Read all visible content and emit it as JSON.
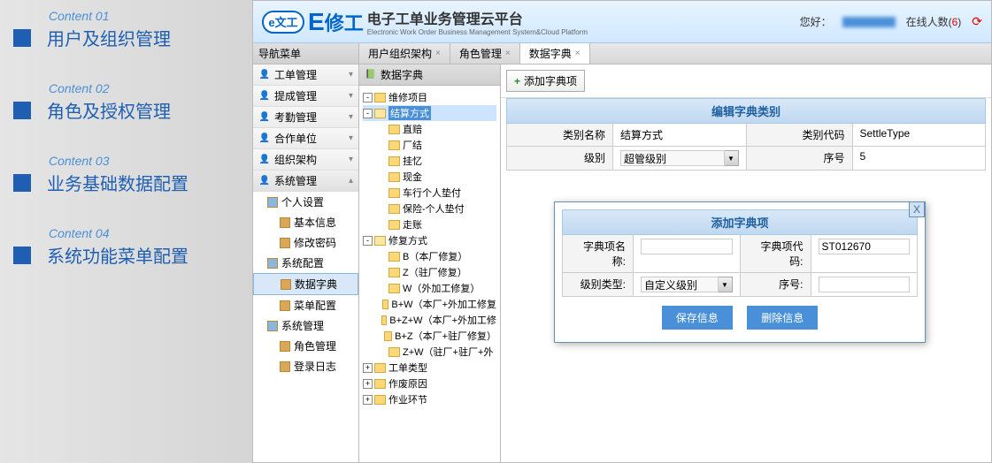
{
  "left_panel": {
    "items": [
      {
        "label": "Content 01",
        "title": "用户及组织管理"
      },
      {
        "label": "Content 02",
        "title": "角色及授权管理"
      },
      {
        "label": "Content 03",
        "title": "业务基础数据配置"
      },
      {
        "label": "Content 04",
        "title": "系统功能菜单配置"
      }
    ]
  },
  "header": {
    "logo_small": "e文工",
    "logo_e": "E",
    "logo_text": "修工",
    "title_cn": "电子工单业务管理云平台",
    "title_en": "Electronic Work Order Business Management System&Cloud Platform",
    "greeting": "您好：",
    "online_label": "在线人数(",
    "online_count": "6",
    "online_close": ")"
  },
  "nav": {
    "header": "导航菜单",
    "items": [
      {
        "label": "工单管理"
      },
      {
        "label": "提成管理"
      },
      {
        "label": "考勤管理"
      },
      {
        "label": "合作单位"
      },
      {
        "label": "组织架构"
      },
      {
        "label": "系统管理",
        "active": true
      }
    ],
    "sub_groups": [
      {
        "label": "个人设置",
        "children": [
          {
            "label": "基本信息"
          },
          {
            "label": "修改密码"
          }
        ]
      },
      {
        "label": "系统配置",
        "children": [
          {
            "label": "数据字典",
            "selected": true
          },
          {
            "label": "菜单配置"
          }
        ]
      },
      {
        "label": "系统管理",
        "children": [
          {
            "label": "角色管理"
          },
          {
            "label": "登录日志"
          }
        ]
      }
    ]
  },
  "tabs": [
    {
      "label": "用户组织架构"
    },
    {
      "label": "角色管理"
    },
    {
      "label": "数据字典",
      "active": true
    }
  ],
  "tree": {
    "header": "数据字典",
    "nodes": [
      {
        "level": 0,
        "toggle": "-",
        "label": "维修项目"
      },
      {
        "level": 0,
        "toggle": "-",
        "label": "结算方式",
        "selected": true,
        "open": true
      },
      {
        "level": 1,
        "label": "直赔"
      },
      {
        "level": 1,
        "label": "厂结"
      },
      {
        "level": 1,
        "label": "挂忆"
      },
      {
        "level": 1,
        "label": "现金"
      },
      {
        "level": 1,
        "label": "车行个人垫付"
      },
      {
        "level": 1,
        "label": "保险-个人垫付"
      },
      {
        "level": 1,
        "label": "走账"
      },
      {
        "level": 0,
        "toggle": "-",
        "label": "修复方式",
        "open": true
      },
      {
        "level": 1,
        "label": "B（本厂修复）"
      },
      {
        "level": 1,
        "label": "Z（驻厂修复）"
      },
      {
        "level": 1,
        "label": "W（外加工修复）"
      },
      {
        "level": 1,
        "label": "B+W（本厂+外加工修复"
      },
      {
        "level": 1,
        "label": "B+Z+W（本厂+外加工修"
      },
      {
        "level": 1,
        "label": "B+Z（本厂+驻厂修复）"
      },
      {
        "level": 1,
        "label": "Z+W（驻厂+驻厂+外"
      },
      {
        "level": 0,
        "toggle": "+",
        "label": "工单类型"
      },
      {
        "level": 0,
        "toggle": "+",
        "label": "作废原因"
      },
      {
        "level": 0,
        "toggle": "+",
        "label": "作业环节"
      }
    ]
  },
  "toolbar": {
    "add_button": "添加字典项"
  },
  "edit_form": {
    "title": "编辑字典类别",
    "rows": [
      {
        "label1": "类别名称",
        "value1": "结算方式",
        "label2": "类别代码",
        "value2": "SettleType"
      },
      {
        "label1": "级别",
        "value1": "超管级别",
        "label2": "序号",
        "value2": "5"
      }
    ]
  },
  "dialog": {
    "title": "添加字典项",
    "rows": [
      {
        "label1": "字典项名称:",
        "value1": "",
        "label2": "字典项代码:",
        "value2": "ST012670"
      },
      {
        "label1": "级别类型:",
        "value1": "自定义级别",
        "dropdown": true,
        "label2": "序号:",
        "value2": ""
      }
    ],
    "save": "保存信息",
    "delete": "删除信息"
  }
}
